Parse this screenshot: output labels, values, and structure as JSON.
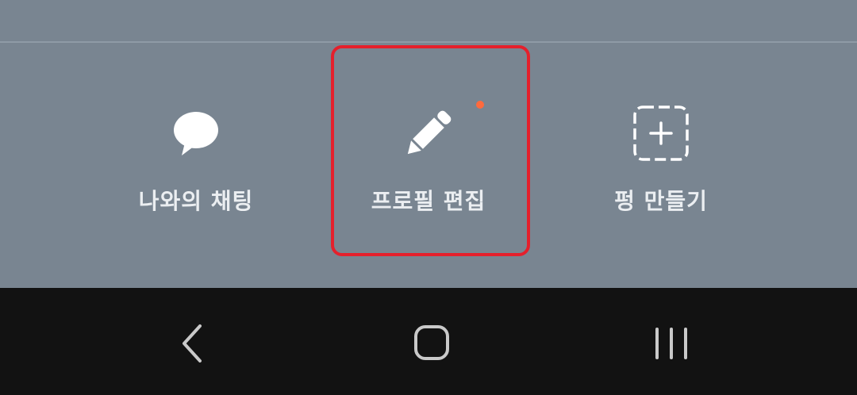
{
  "actions": [
    {
      "label": "나와의 채팅",
      "icon": "chat-bubble-icon"
    },
    {
      "label": "프로필 편집",
      "icon": "pencil-icon",
      "has_new_badge": true
    },
    {
      "label": "펑 만들기",
      "icon": "dashed-plus-square-icon"
    }
  ],
  "nav": {
    "back_icon": "back-icon",
    "home_icon": "home-icon",
    "recents_icon": "recents-icon"
  },
  "colors": {
    "panel_bg": "#798591",
    "nav_bg": "#121212",
    "highlight": "#e5202c",
    "badge": "#ff6a3d",
    "label": "#ebeef1"
  }
}
